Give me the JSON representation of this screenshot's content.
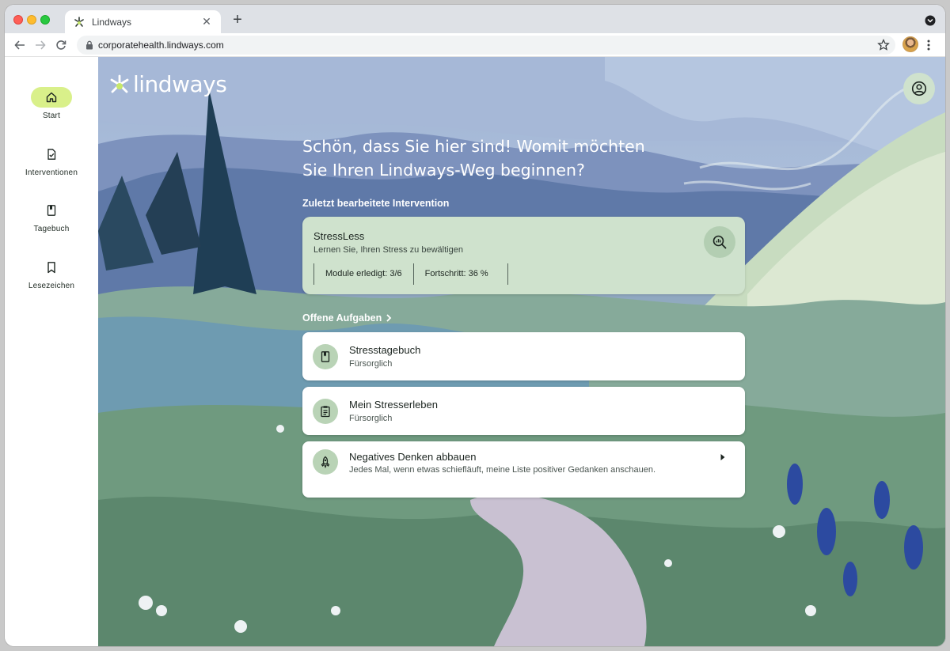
{
  "browser": {
    "tab_title": "Lindways",
    "url": "corporatehealth.lindways.com"
  },
  "sidebar": {
    "items": [
      {
        "label": "Start",
        "icon": "home-icon",
        "active": true
      },
      {
        "label": "Interventionen",
        "icon": "clipboard-check-icon",
        "active": false
      },
      {
        "label": "Tagebuch",
        "icon": "diary-book-icon",
        "active": false
      },
      {
        "label": "Lesezeichen",
        "icon": "bookmark-icon",
        "active": false
      }
    ]
  },
  "brand": {
    "name": "lindways"
  },
  "main": {
    "welcome_line1": "Schön, dass Sie hier sind! Womit möchten",
    "welcome_line2": "Sie Ihren Lindways-Weg beginnen?",
    "recent_label": "Zuletzt bearbeitete Intervention",
    "recent": {
      "title": "StressLess",
      "subtitle": "Lernen Sie, Ihren Stress zu bewältigen",
      "modules": "Module erledigt: 3/6",
      "progress": "Fortschritt: 36 %"
    },
    "tasks_label": "Offene Aufgaben",
    "tasks": [
      {
        "title": "Stresstagebuch",
        "subtitle": "Fürsorglich",
        "icon": "diary-book-icon"
      },
      {
        "title": "Mein Stresserleben",
        "subtitle": "Fürsorglich",
        "icon": "clipboard-list-icon"
      },
      {
        "title": "Negatives Denken abbauen",
        "subtitle": "Jedes Mal, wenn etwas schiefläuft, meine Liste positiver Gedanken anschauen.",
        "icon": "rocket-icon"
      }
    ]
  },
  "colors": {
    "accent_pill": "#d9f08a",
    "card_green": "#cfe2cd",
    "icon_green": "#b9d3b6"
  }
}
